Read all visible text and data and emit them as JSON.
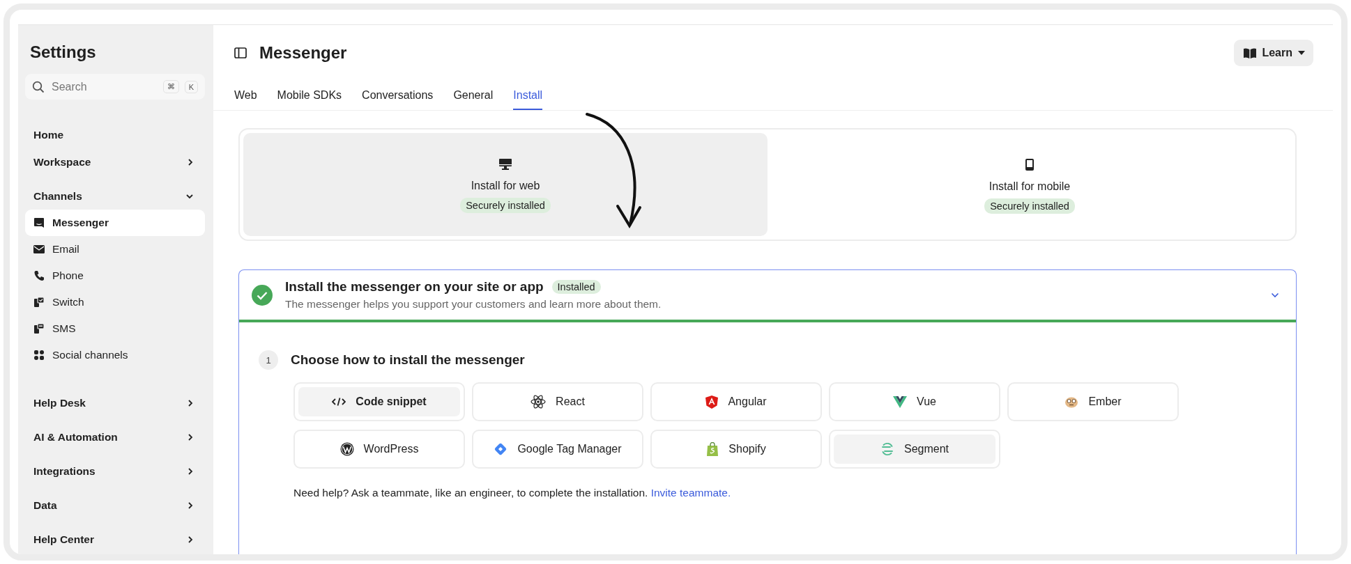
{
  "sidebar": {
    "title": "Settings",
    "search": {
      "placeholder": "Search",
      "shortcut_keys": [
        "⌘",
        "K"
      ]
    },
    "items": [
      {
        "label": "Home",
        "kind": "link"
      },
      {
        "label": "Workspace",
        "kind": "group",
        "expanded": false
      },
      {
        "label": "Channels",
        "kind": "group",
        "expanded": true,
        "children": [
          {
            "label": "Messenger",
            "kind": "messenger",
            "selected": true
          },
          {
            "label": "Email",
            "kind": "email",
            "selected": false
          },
          {
            "label": "Phone",
            "kind": "phone",
            "selected": false
          },
          {
            "label": "Switch",
            "kind": "switch",
            "selected": false
          },
          {
            "label": "SMS",
            "kind": "sms",
            "selected": false
          },
          {
            "label": "Social channels",
            "kind": "social",
            "selected": false
          }
        ]
      },
      {
        "label": "Help Desk",
        "kind": "group",
        "expanded": false
      },
      {
        "label": "AI & Automation",
        "kind": "group",
        "expanded": false
      },
      {
        "label": "Integrations",
        "kind": "group",
        "expanded": false
      },
      {
        "label": "Data",
        "kind": "group",
        "expanded": false
      },
      {
        "label": "Help Center",
        "kind": "group",
        "expanded": false
      }
    ]
  },
  "header": {
    "title": "Messenger",
    "learn_button": "Learn"
  },
  "tabs": [
    {
      "label": "Web",
      "selected": false
    },
    {
      "label": "Mobile SDKs",
      "selected": false
    },
    {
      "label": "Conversations",
      "selected": false
    },
    {
      "label": "General",
      "selected": false
    },
    {
      "label": "Install",
      "selected": true
    }
  ],
  "install_targets": [
    {
      "label": "Install for web",
      "kind": "web",
      "status": "Securely installed",
      "selected": true
    },
    {
      "label": "Install for mobile",
      "kind": "mobile",
      "status": "Securely installed",
      "selected": false
    }
  ],
  "section": {
    "title": "Install the messenger on your site or app",
    "badge": "Installed",
    "description": "The messenger helps you support your customers and learn more about them.",
    "completed": true,
    "expanded": true,
    "step": {
      "number": "1",
      "title": "Choose how to install the messenger",
      "options": [
        {
          "label": "Code snippet",
          "kind": "code",
          "selected": true,
          "hovered": false
        },
        {
          "label": "React",
          "kind": "react",
          "selected": false,
          "hovered": false
        },
        {
          "label": "Angular",
          "kind": "angular",
          "selected": false,
          "hovered": false
        },
        {
          "label": "Vue",
          "kind": "vue",
          "selected": false,
          "hovered": false
        },
        {
          "label": "Ember",
          "kind": "ember",
          "selected": false,
          "hovered": false
        },
        {
          "label": "WordPress",
          "kind": "wordpress",
          "selected": false,
          "hovered": false
        },
        {
          "label": "Google Tag Manager",
          "kind": "gtm",
          "selected": false,
          "hovered": false
        },
        {
          "label": "Shopify",
          "kind": "shopify",
          "selected": false,
          "hovered": false
        },
        {
          "label": "Segment",
          "kind": "segment",
          "selected": false,
          "hovered": true
        }
      ],
      "help_text": "Need help? Ask a teammate, like an engineer, to complete the installation.",
      "help_link": "Invite teammate."
    }
  }
}
